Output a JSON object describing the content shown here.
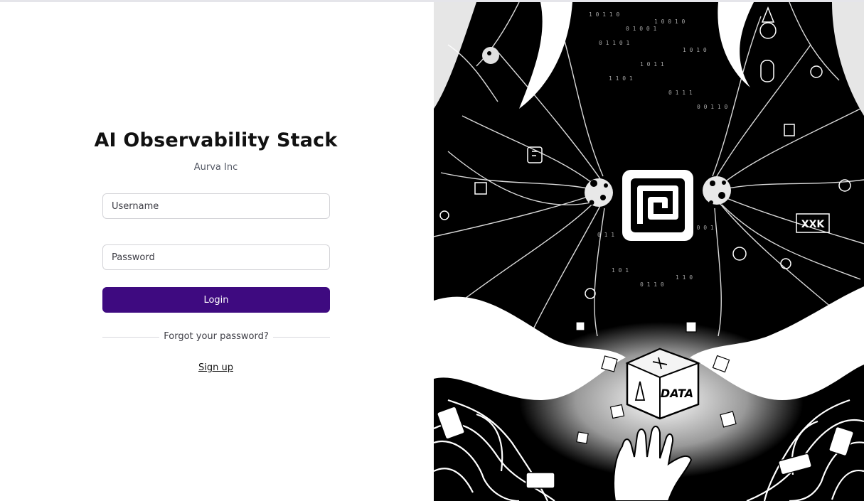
{
  "form": {
    "title": "AI Observability Stack",
    "organization": "Aurva Inc",
    "username_placeholder": "Username",
    "username_value": "",
    "password_placeholder": "Password",
    "password_value": "",
    "login_label": "Login",
    "forgot_label": "Forgot your password?",
    "signup_label": "Sign up"
  },
  "artwork": {
    "cube_label": "DATA",
    "glyph_label": "XXK",
    "theme_colors": {
      "primary_button": "#3e0a80",
      "art_background": "#000000",
      "art_foreground": "#ffffff"
    }
  }
}
